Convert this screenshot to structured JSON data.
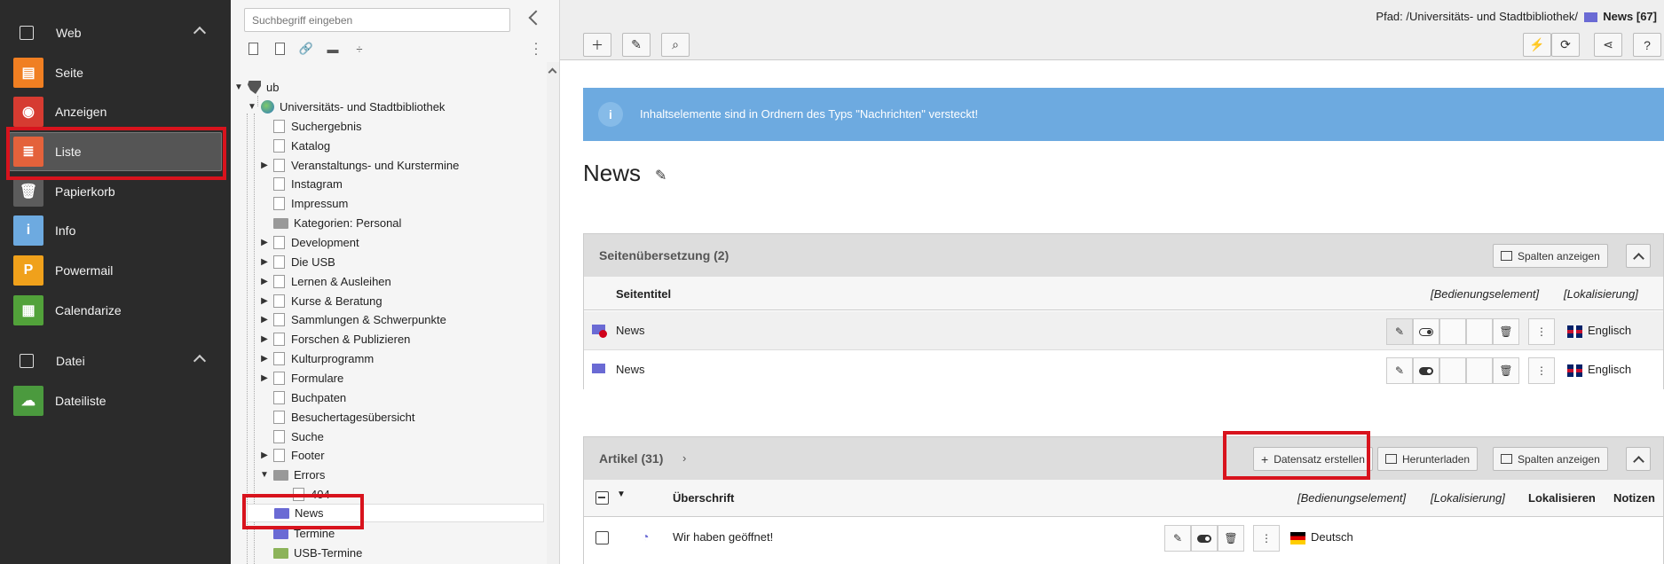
{
  "modules": {
    "groups": [
      {
        "label": "Web",
        "icon": "page-icon"
      },
      {
        "label": "Datei",
        "icon": "image-icon"
      }
    ],
    "items": [
      {
        "label": "Seite",
        "icon": "page-module-icon",
        "color": "#f07f22"
      },
      {
        "label": "Anzeigen",
        "icon": "eye-icon",
        "color": "#d63b31"
      },
      {
        "label": "Liste",
        "icon": "list-icon",
        "color": "#e4623b"
      },
      {
        "label": "Papierkorb",
        "icon": "trash-icon",
        "color": "#5c5c5c"
      },
      {
        "label": "Info",
        "icon": "info-icon",
        "color": "#6daae0"
      },
      {
        "label": "Powermail",
        "icon": "powermail-icon",
        "color": "#f0a11b"
      },
      {
        "label": "Calendarize",
        "icon": "calendar-icon",
        "color": "#52a23a"
      },
      {
        "label": "Dateiliste",
        "icon": "cloud-icon",
        "color": "#4b9a3e"
      }
    ]
  },
  "tree": {
    "search_placeholder": "Suchbegriff eingeben",
    "nodes": [
      {
        "label": "ub",
        "toggle": "▼"
      },
      {
        "label": "Universitäts- und Stadtbibliothek",
        "toggle": "▼"
      },
      {
        "label": "Suchergebnis",
        "toggle": ""
      },
      {
        "label": "Katalog",
        "toggle": ""
      },
      {
        "label": "Veranstaltungs- und Kurstermine",
        "toggle": "▶"
      },
      {
        "label": "Instagram",
        "toggle": ""
      },
      {
        "label": "Impressum",
        "toggle": ""
      },
      {
        "label": "Kategorien: Personal",
        "toggle": ""
      },
      {
        "label": "Development",
        "toggle": "▶"
      },
      {
        "label": "Die USB",
        "toggle": "▶"
      },
      {
        "label": "Lernen & Ausleihen",
        "toggle": "▶"
      },
      {
        "label": "Kurse & Beratung",
        "toggle": "▶"
      },
      {
        "label": "Sammlungen & Schwerpunkte",
        "toggle": "▶"
      },
      {
        "label": "Forschen & Publizieren",
        "toggle": "▶"
      },
      {
        "label": "Kulturprogramm",
        "toggle": "▶"
      },
      {
        "label": "Formulare",
        "toggle": "▶"
      },
      {
        "label": "Buchpaten",
        "toggle": ""
      },
      {
        "label": "Besuchertagesübersicht",
        "toggle": ""
      },
      {
        "label": "Suche",
        "toggle": ""
      },
      {
        "label": "Footer",
        "toggle": "▶"
      },
      {
        "label": "Errors",
        "toggle": "▼"
      },
      {
        "label": "404",
        "toggle": ""
      },
      {
        "label": "News",
        "toggle": ""
      },
      {
        "label": "Termine",
        "toggle": ""
      },
      {
        "label": "USB-Termine",
        "toggle": ""
      }
    ]
  },
  "header": {
    "path_prefix": "Pfad: /Universitäts- und Stadtbibliothek/",
    "path_current": "News [67]"
  },
  "info": {
    "text": "Inhaltselemente sind in Ordnern des Typs \"Nachrichten\" versteckt!"
  },
  "page": {
    "title": "News"
  },
  "translation_panel": {
    "title": "Seitenübersetzung (2)",
    "columns_button": "Spalten anzeigen",
    "col_title": "Seitentitel",
    "col_control": "[Bedienungselement]",
    "col_localization": "[Lokalisierung]",
    "rows": [
      {
        "title": "News",
        "language": "Englisch"
      },
      {
        "title": "News",
        "language": "Englisch"
      }
    ]
  },
  "articles_panel": {
    "title": "Artikel (31)",
    "create_button": "Datensatz erstellen",
    "download_button": "Herunterladen",
    "columns_button": "Spalten anzeigen",
    "col_headline": "Überschrift",
    "col_control": "[Bedienungselement]",
    "col_localization": "[Lokalisierung]",
    "col_localize": "Lokalisieren",
    "col_notes": "Notizen",
    "rows": [
      {
        "title": "Wir haben geöffnet!",
        "language": "Deutsch"
      }
    ]
  }
}
